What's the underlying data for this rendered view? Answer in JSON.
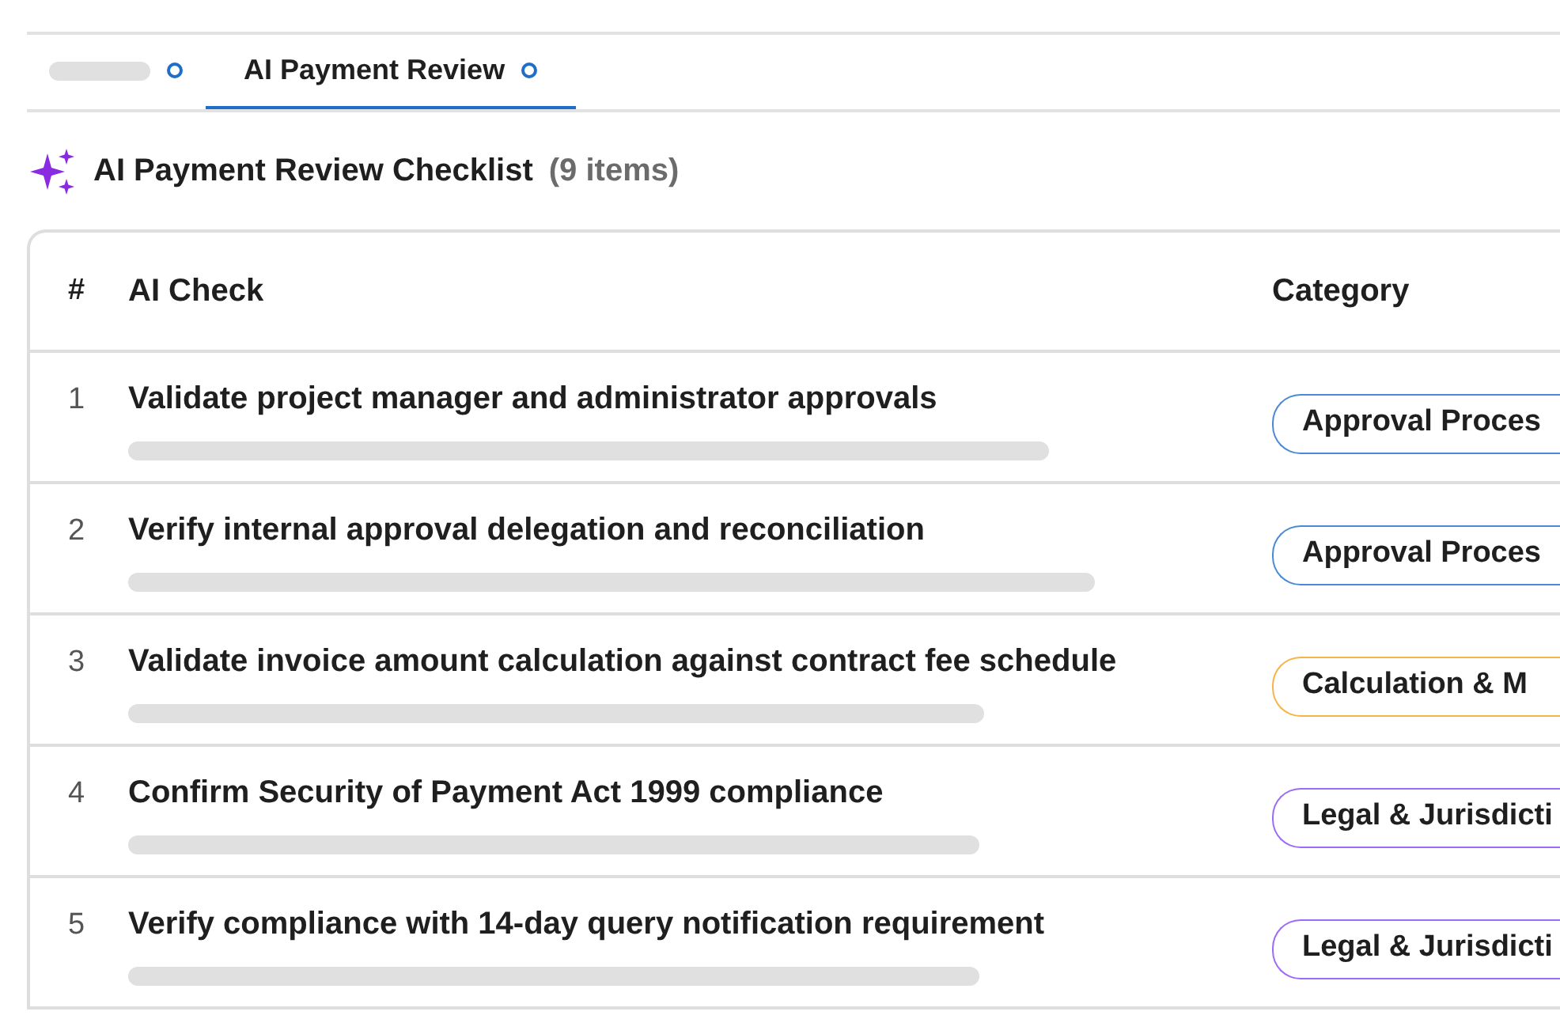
{
  "tabs": [
    {
      "selected": false
    },
    {
      "label": "AI Payment Review",
      "selected": true
    }
  ],
  "heading": {
    "title": "AI Payment Review Checklist",
    "count": "(9 items)"
  },
  "table": {
    "columns": [
      "#",
      "AI Check",
      "Category"
    ],
    "rows": [
      {
        "number": "1",
        "check": "Validate project manager and administrator approvals",
        "category": "Approval Proces",
        "color": "#4a8ad4"
      },
      {
        "number": "2",
        "check": "Verify internal approval delegation and reconciliation",
        "category": "Approval Proces",
        "color": "#4a8ad4"
      },
      {
        "number": "3",
        "check": "Validate invoice amount calculation against contract fee schedule",
        "category": "Calculation & M",
        "color": "#f5b449"
      },
      {
        "number": "4",
        "check": "Confirm Security of Payment Act 1999 compliance",
        "category": "Legal & Jurisdicti",
        "color": "#9b6cf5"
      },
      {
        "number": "5",
        "check": "Verify compliance with 14-day query notification requirement",
        "category": "Legal & Jurisdicti",
        "color": "#9b6cf5"
      }
    ]
  }
}
